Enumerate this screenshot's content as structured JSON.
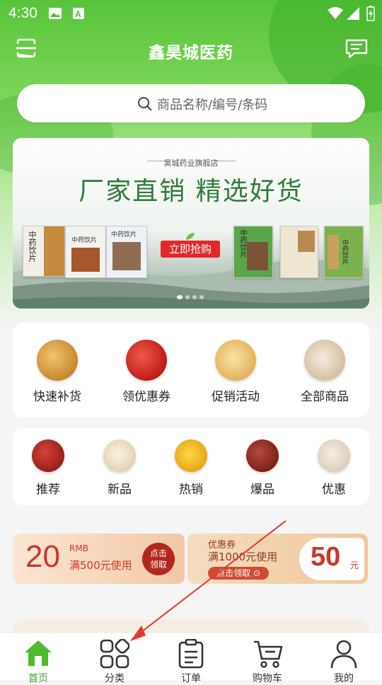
{
  "status_bar": {
    "time": "4:30",
    "icons": [
      "image-icon",
      "font-icon",
      "wifi-icon",
      "signal-icon",
      "battery-icon"
    ]
  },
  "header": {
    "title": "鑫昊城医药",
    "left_icon": "scan-icon",
    "right_icon": "message-icon"
  },
  "search": {
    "placeholder": "商品名称/编号/条码",
    "icon": "search-icon"
  },
  "banner": {
    "store_name": "昊城药业旗舰店",
    "headline": "厂家直销  精选好货",
    "button_label": "立即抢购",
    "package_texts": [
      "中药饮片",
      "中药饮片",
      "中药饮片",
      "中药饮片",
      "中药饮片"
    ],
    "page_count": 4,
    "active_page": 1
  },
  "quick_menu": [
    {
      "label": "快速补货",
      "icon": "herb-root-icon"
    },
    {
      "label": "领优惠券",
      "icon": "goji-icon"
    },
    {
      "label": "促销活动",
      "icon": "herb-slices-icon"
    },
    {
      "label": "全部商品",
      "icon": "mixed-herbs-icon"
    }
  ],
  "category_menu": [
    {
      "label": "推荐",
      "icon": "jujube-icon"
    },
    {
      "label": "新品",
      "icon": "white-slices-icon"
    },
    {
      "label": "热销",
      "icon": "chrysanthemum-icon"
    },
    {
      "label": "爆品",
      "icon": "red-dates-icon"
    },
    {
      "label": "优惠",
      "icon": "pale-slices-icon"
    }
  ],
  "coupons": [
    {
      "amount": "20",
      "unit": "RMB",
      "condition": "满500元使用",
      "button": "点击\n领取"
    },
    {
      "title": "优惠券",
      "condition": "满1000元使用",
      "button": "点击领取 ⊙",
      "amount": "50",
      "unit": "元"
    }
  ],
  "tab_bar": [
    {
      "label": "首页",
      "icon": "home-icon",
      "active": true
    },
    {
      "label": "分类",
      "icon": "category-icon",
      "active": false
    },
    {
      "label": "订单",
      "icon": "order-icon",
      "active": false
    },
    {
      "label": "购物车",
      "icon": "cart-icon",
      "active": false
    },
    {
      "label": "我的",
      "icon": "user-icon",
      "active": false
    }
  ],
  "colors": {
    "brand_green": "#4cbb2e",
    "accent_red": "#c9372c",
    "arrow_red": "#e03a2f"
  }
}
